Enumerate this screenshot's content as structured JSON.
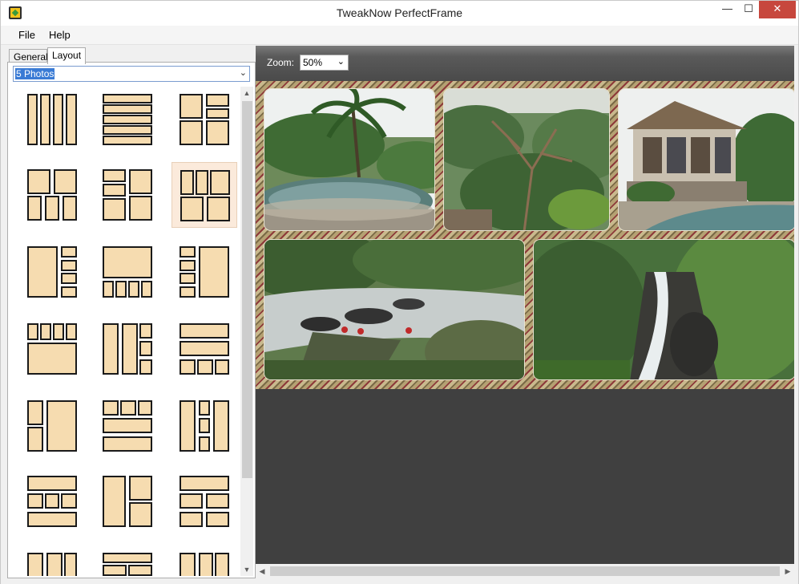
{
  "window": {
    "title": "TweakNow PerfectFrame",
    "minimize_glyph": "—",
    "maximize_glyph": "☐",
    "close_glyph": "✕"
  },
  "menu": {
    "file": "File",
    "help": "Help"
  },
  "tabs": {
    "general": "General",
    "layout": "Layout"
  },
  "photo_count_select": {
    "value": "5 Photos"
  },
  "zoom": {
    "label": "Zoom:",
    "value": "50%"
  },
  "layout_thumbnails": {
    "selected_index": 5,
    "count": 21
  },
  "icons": {
    "app": "app-icon",
    "dropdown": "chevron-down-icon",
    "scroll_up": "scroll-up-arrow-icon",
    "scroll_down": "scroll-down-arrow-icon",
    "scroll_left": "scroll-left-arrow-icon",
    "scroll_right": "scroll-right-arrow-icon"
  },
  "colors": {
    "close_button": "#c7473d",
    "thumb_fill": "#f6dcb0",
    "thumb_selected_bg": "#fbeadb",
    "canvas_bg": "#404040",
    "selection_highlight": "#3a7bd5"
  }
}
